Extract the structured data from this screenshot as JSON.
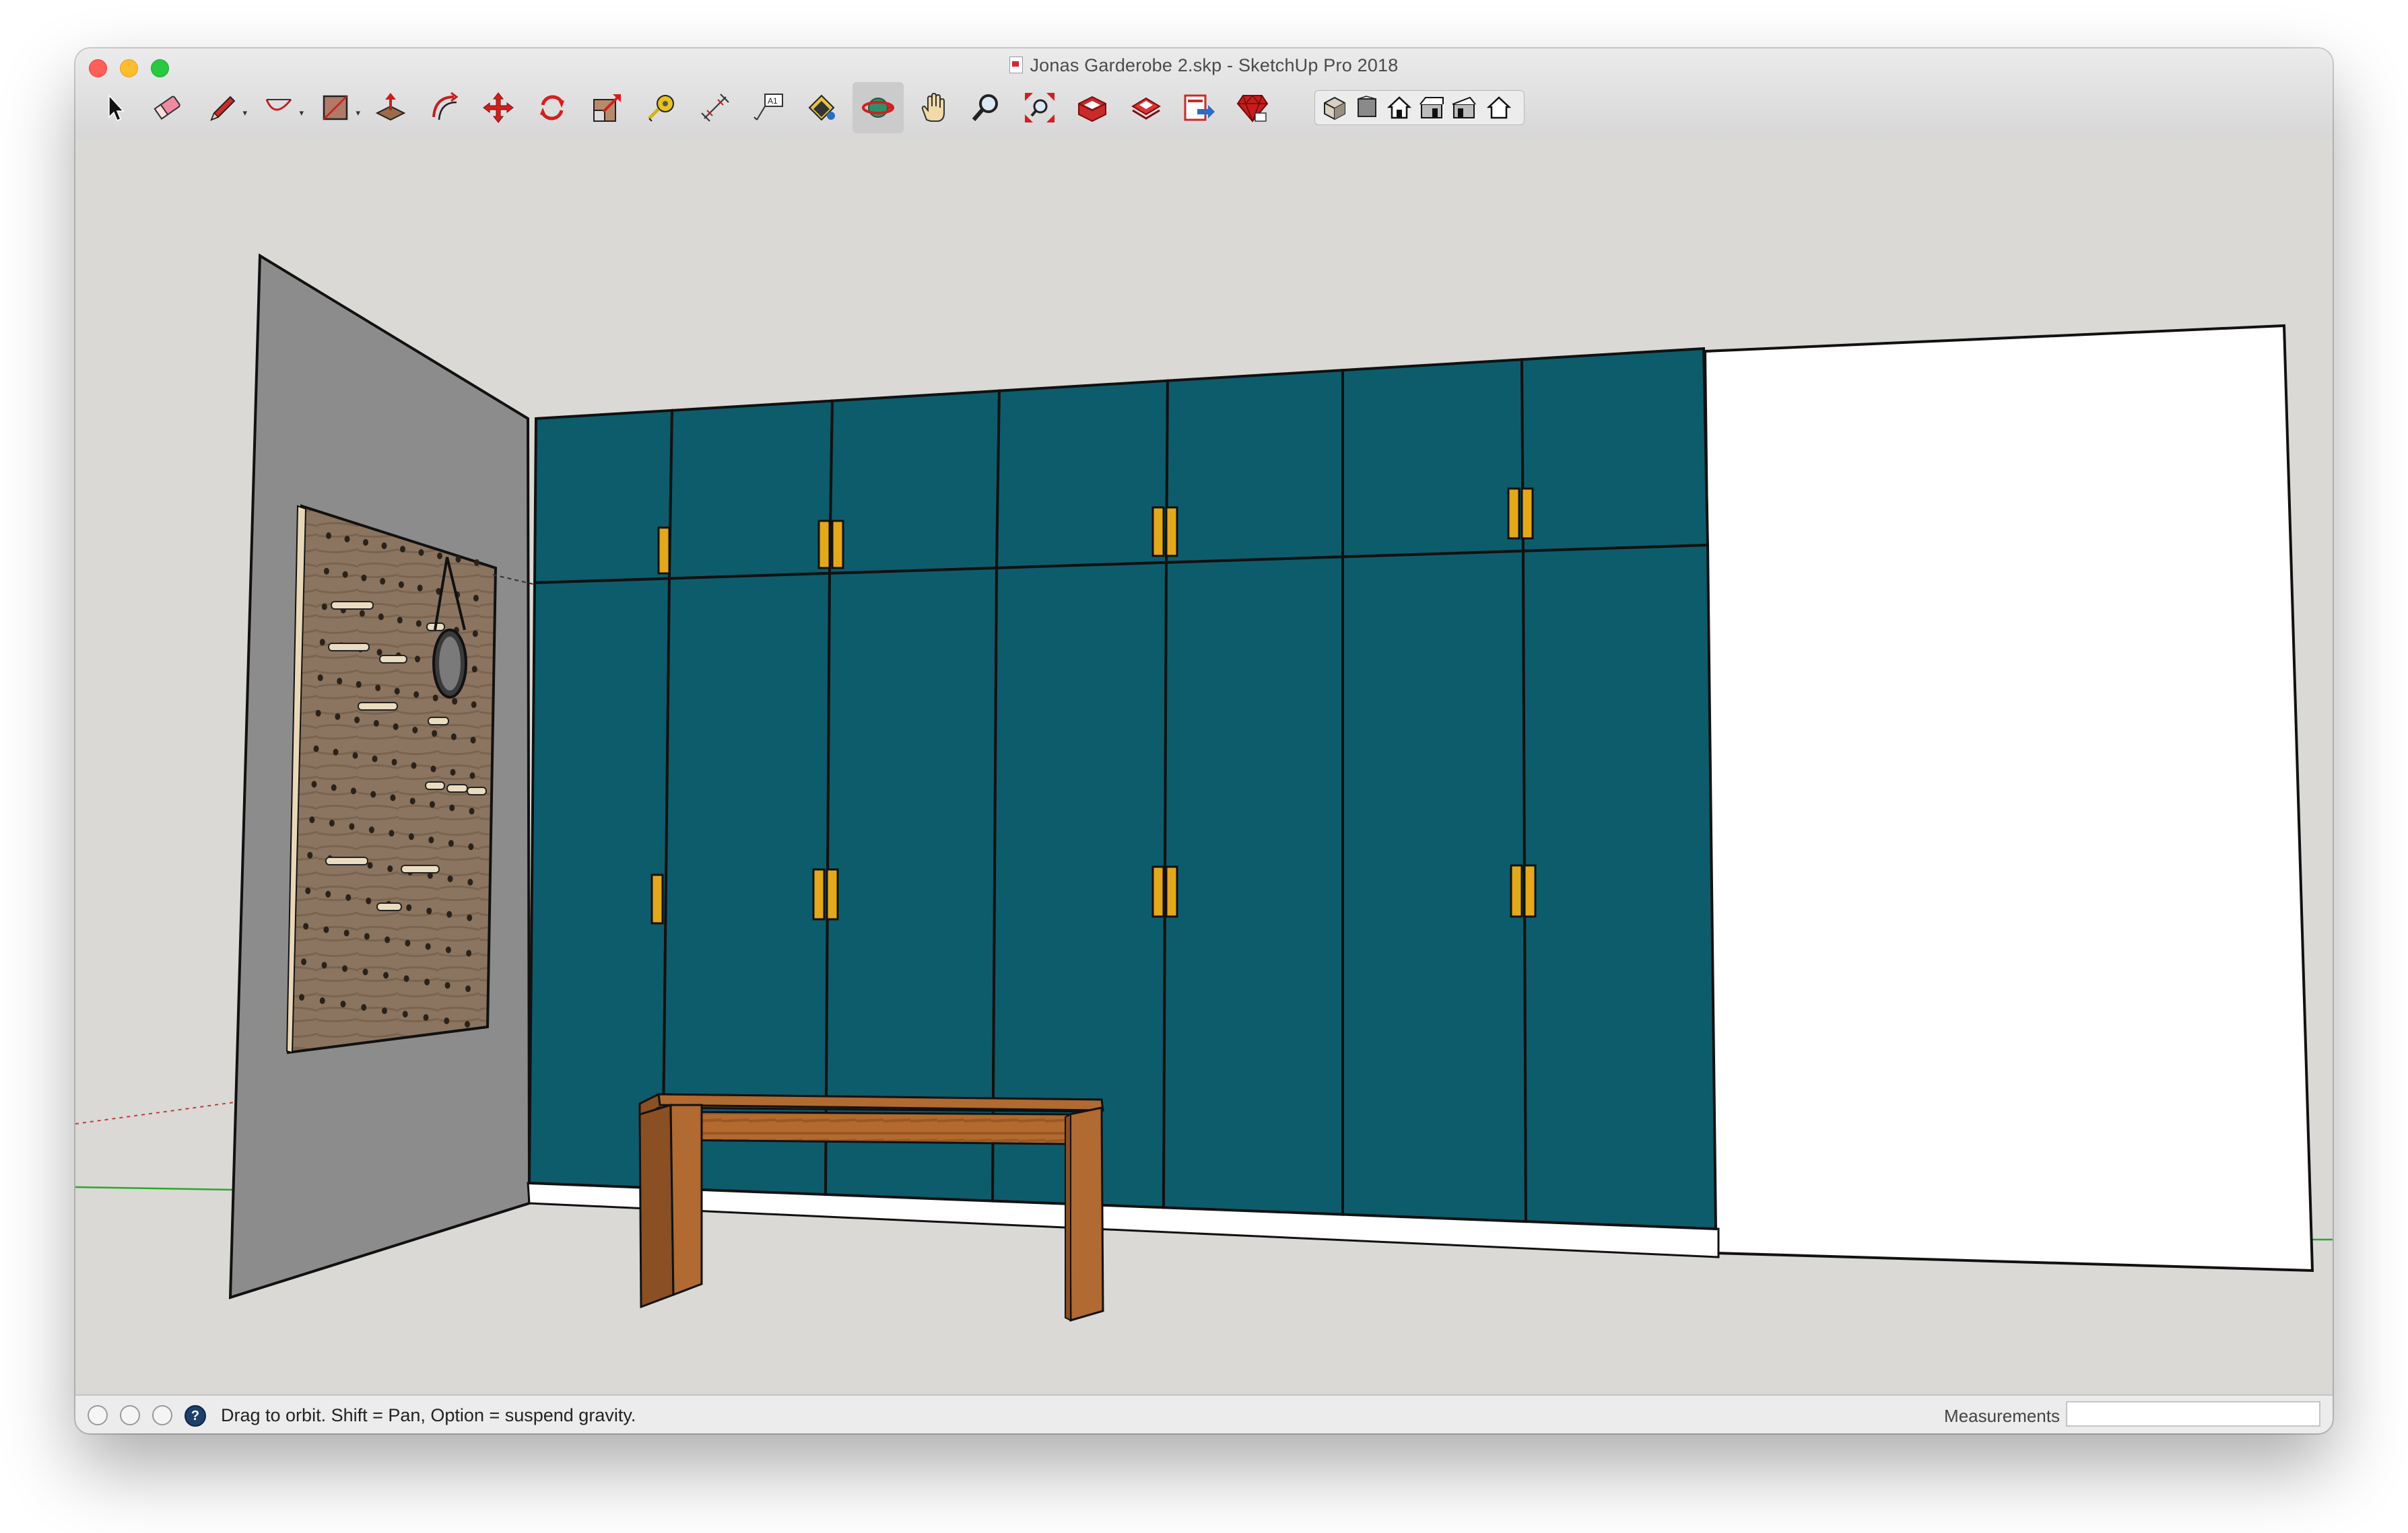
{
  "window": {
    "title": "Jonas Garderobe 2.skp - SketchUp Pro 2018"
  },
  "toolbar": {
    "tools": [
      {
        "name": "select-tool",
        "icon": "arrow-cursor-icon"
      },
      {
        "name": "eraser-tool",
        "icon": "eraser-icon"
      },
      {
        "name": "line-tool",
        "icon": "pencil-icon",
        "has_dropdown": true
      },
      {
        "name": "arc-tool",
        "icon": "arc-icon",
        "has_dropdown": true
      },
      {
        "name": "shape-tool",
        "icon": "rectangle-icon",
        "has_dropdown": true
      },
      {
        "name": "push-pull-tool",
        "icon": "push-pull-icon"
      },
      {
        "name": "offset-tool",
        "icon": "offset-icon"
      },
      {
        "name": "move-tool",
        "icon": "move-icon"
      },
      {
        "name": "rotate-tool",
        "icon": "rotate-icon"
      },
      {
        "name": "scale-tool",
        "icon": "scale-icon"
      },
      {
        "name": "tape-measure-tool",
        "icon": "tape-measure-icon"
      },
      {
        "name": "dimension-tool",
        "icon": "dimension-icon"
      },
      {
        "name": "text-tool",
        "icon": "text-label-icon",
        "label": "A1"
      },
      {
        "name": "paint-bucket-tool",
        "icon": "paint-bucket-icon"
      },
      {
        "name": "orbit-tool",
        "icon": "orbit-icon",
        "active": true
      },
      {
        "name": "pan-tool",
        "icon": "hand-icon"
      },
      {
        "name": "zoom-tool",
        "icon": "magnifier-icon"
      },
      {
        "name": "zoom-extents-tool",
        "icon": "zoom-extents-icon"
      },
      {
        "name": "warehouse-tool",
        "icon": "3d-warehouse-icon"
      },
      {
        "name": "extension-warehouse-tool",
        "icon": "extension-warehouse-icon"
      },
      {
        "name": "layout-tool",
        "icon": "send-to-layout-icon"
      },
      {
        "name": "ruby-console-tool",
        "icon": "ruby-gem-icon"
      }
    ],
    "views": [
      {
        "name": "iso-view",
        "icon": "iso-view-icon"
      },
      {
        "name": "top-view",
        "icon": "top-view-icon"
      },
      {
        "name": "front-view",
        "icon": "front-view-icon"
      },
      {
        "name": "right-view",
        "icon": "right-view-icon"
      },
      {
        "name": "back-view",
        "icon": "back-view-icon"
      },
      {
        "name": "left-view",
        "icon": "left-view-icon"
      }
    ]
  },
  "scene": {
    "colors": {
      "background": "#dad9d5",
      "cabinet": "#0d5c6c",
      "handle": "#e3a81c",
      "left_wall": "#8c8c8c",
      "pegboard": "#7e6b57",
      "bench": "#9a5c2c",
      "white_wall": "#ffffff",
      "axis_green": "#2aa82a",
      "axis_red": "#c43a3a"
    }
  },
  "statusbar": {
    "text": "Drag to orbit. Shift = Pan, Option = suspend gravity.",
    "measurements_label": "Measurements",
    "measurements_value": "",
    "icons": [
      "geo-location-icon",
      "credits-icon",
      "user-account-icon",
      "help-icon"
    ]
  }
}
